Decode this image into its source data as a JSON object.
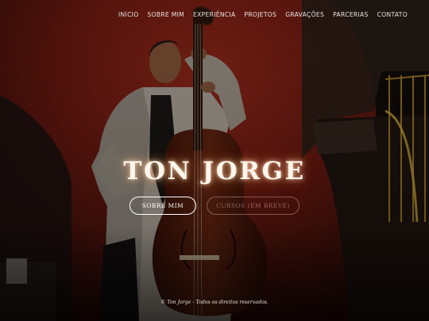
{
  "nav": {
    "items": [
      {
        "label": "INÍCIO"
      },
      {
        "label": "SOBRE MIM"
      },
      {
        "label": "EXPERIÊNCIA"
      },
      {
        "label": "PROJETOS"
      },
      {
        "label": "GRAVAÇÕES"
      },
      {
        "label": "PARCERIAS"
      },
      {
        "label": "CONTATO"
      }
    ]
  },
  "hero": {
    "title": "TON JORGE",
    "primary_button": "SOBRE MIM",
    "secondary_button": "CURSOS (EM BREVE)"
  },
  "footer": {
    "text": "© Ton Jorge - Todos os direitos reservados."
  },
  "colors": {
    "background": "#0d0a09",
    "red_wall": "#7a1f14",
    "text": "#ffffff",
    "disabled_text": "#c8a096"
  }
}
